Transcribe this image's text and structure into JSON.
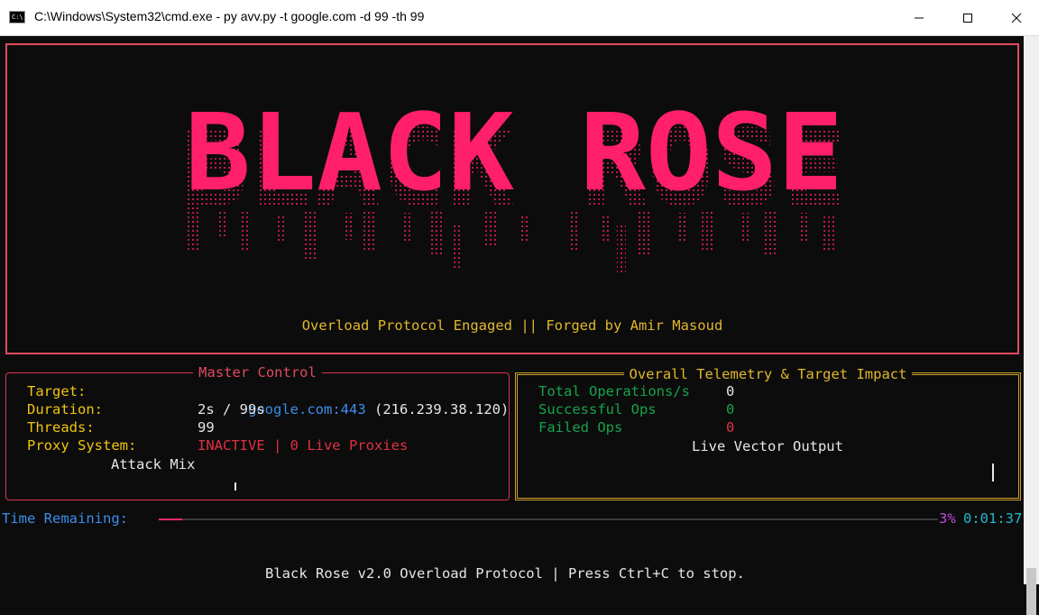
{
  "window": {
    "title": "C:\\Windows\\System32\\cmd.exe - py  avv.py -t google.com -d 99 -th 99",
    "icon": "cmd-icon",
    "controls": [
      "minimize-icon",
      "maximize-icon",
      "close-icon"
    ]
  },
  "banner": {
    "logo_text": "BLACK ROSE",
    "tagline": "Overload Protocol Engaged || Forged by Amir Masoud",
    "colors": {
      "logo": "#ff1f6b",
      "border": "#e04a5f",
      "tagline": "#e2b72c"
    }
  },
  "master_control": {
    "title": "Master Control",
    "target_label": "Target:",
    "target_host": "google.com:443",
    "target_ip": "(216.239.38.120)",
    "duration_label": "Duration:",
    "duration_value": "2s / 99s",
    "threads_label": "Threads:",
    "threads_value": "99",
    "proxy_label": "Proxy System:",
    "proxy_value": "INACTIVE | 0 Live Proxies",
    "attack_mix_label": "Attack Mix"
  },
  "telemetry": {
    "title": "Overall Telemetry & Target Impact",
    "rows": [
      {
        "label": "Total Operations/s",
        "value": "0"
      },
      {
        "label": "Successful Ops",
        "value": "0"
      },
      {
        "label": "Failed Ops",
        "value": "0"
      }
    ],
    "live_vector_label": "Live Vector Output"
  },
  "progress": {
    "label": "Time Remaining:",
    "percent_text": "3%",
    "fraction": 0.03,
    "eta": "0:01:37"
  },
  "footer": {
    "text": "Black Rose v2.0 Overload Protocol | Press Ctrl+C to stop."
  }
}
